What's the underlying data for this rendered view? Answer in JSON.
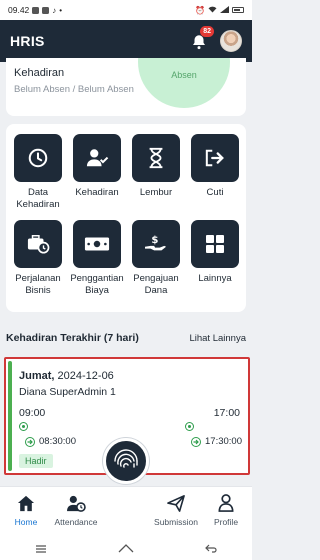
{
  "status_bar": {
    "time": "09.42",
    "battery": ""
  },
  "app_bar": {
    "title": "HRIS",
    "notification_count": "82"
  },
  "kehadiran": {
    "title": "Kehadiran",
    "subtitle": "Belum Absen / Belum Absen",
    "circle_label": "Absen"
  },
  "menu": {
    "items": [
      {
        "label": "Data Kehadiran",
        "icon": "clock-icon"
      },
      {
        "label": "Kehadiran",
        "icon": "user-check-icon"
      },
      {
        "label": "Lembur",
        "icon": "hourglass-icon"
      },
      {
        "label": "Cuti",
        "icon": "exit-icon"
      },
      {
        "label": "Perjalanan Bisnis",
        "icon": "briefcase-clock-icon"
      },
      {
        "label": "Penggantian Biaya",
        "icon": "money-icon"
      },
      {
        "label": "Pengajuan Dana",
        "icon": "hand-money-icon"
      },
      {
        "label": "Lainnya",
        "icon": "grid-icon"
      }
    ]
  },
  "recent": {
    "section_title": "Kehadiran Terakhir (7 hari)",
    "see_more": "Lihat Lainnya",
    "card": {
      "day": "Jumat,",
      "date": "2024-12-06",
      "name": "Diana SuperAdmin 1",
      "schedule_in": "09:00",
      "schedule_out": "17:00",
      "actual_in": "08:30:00",
      "actual_out": "17:30:00",
      "status": "Hadir"
    }
  },
  "bottom_nav": {
    "home": "Home",
    "attendance": "Attendance",
    "submission": "Submission",
    "profile": "Profile"
  },
  "colors": {
    "primary": "#1e2a38",
    "accent": "#1976d2",
    "success": "#2e9d4c",
    "highlight": "#d03838"
  }
}
